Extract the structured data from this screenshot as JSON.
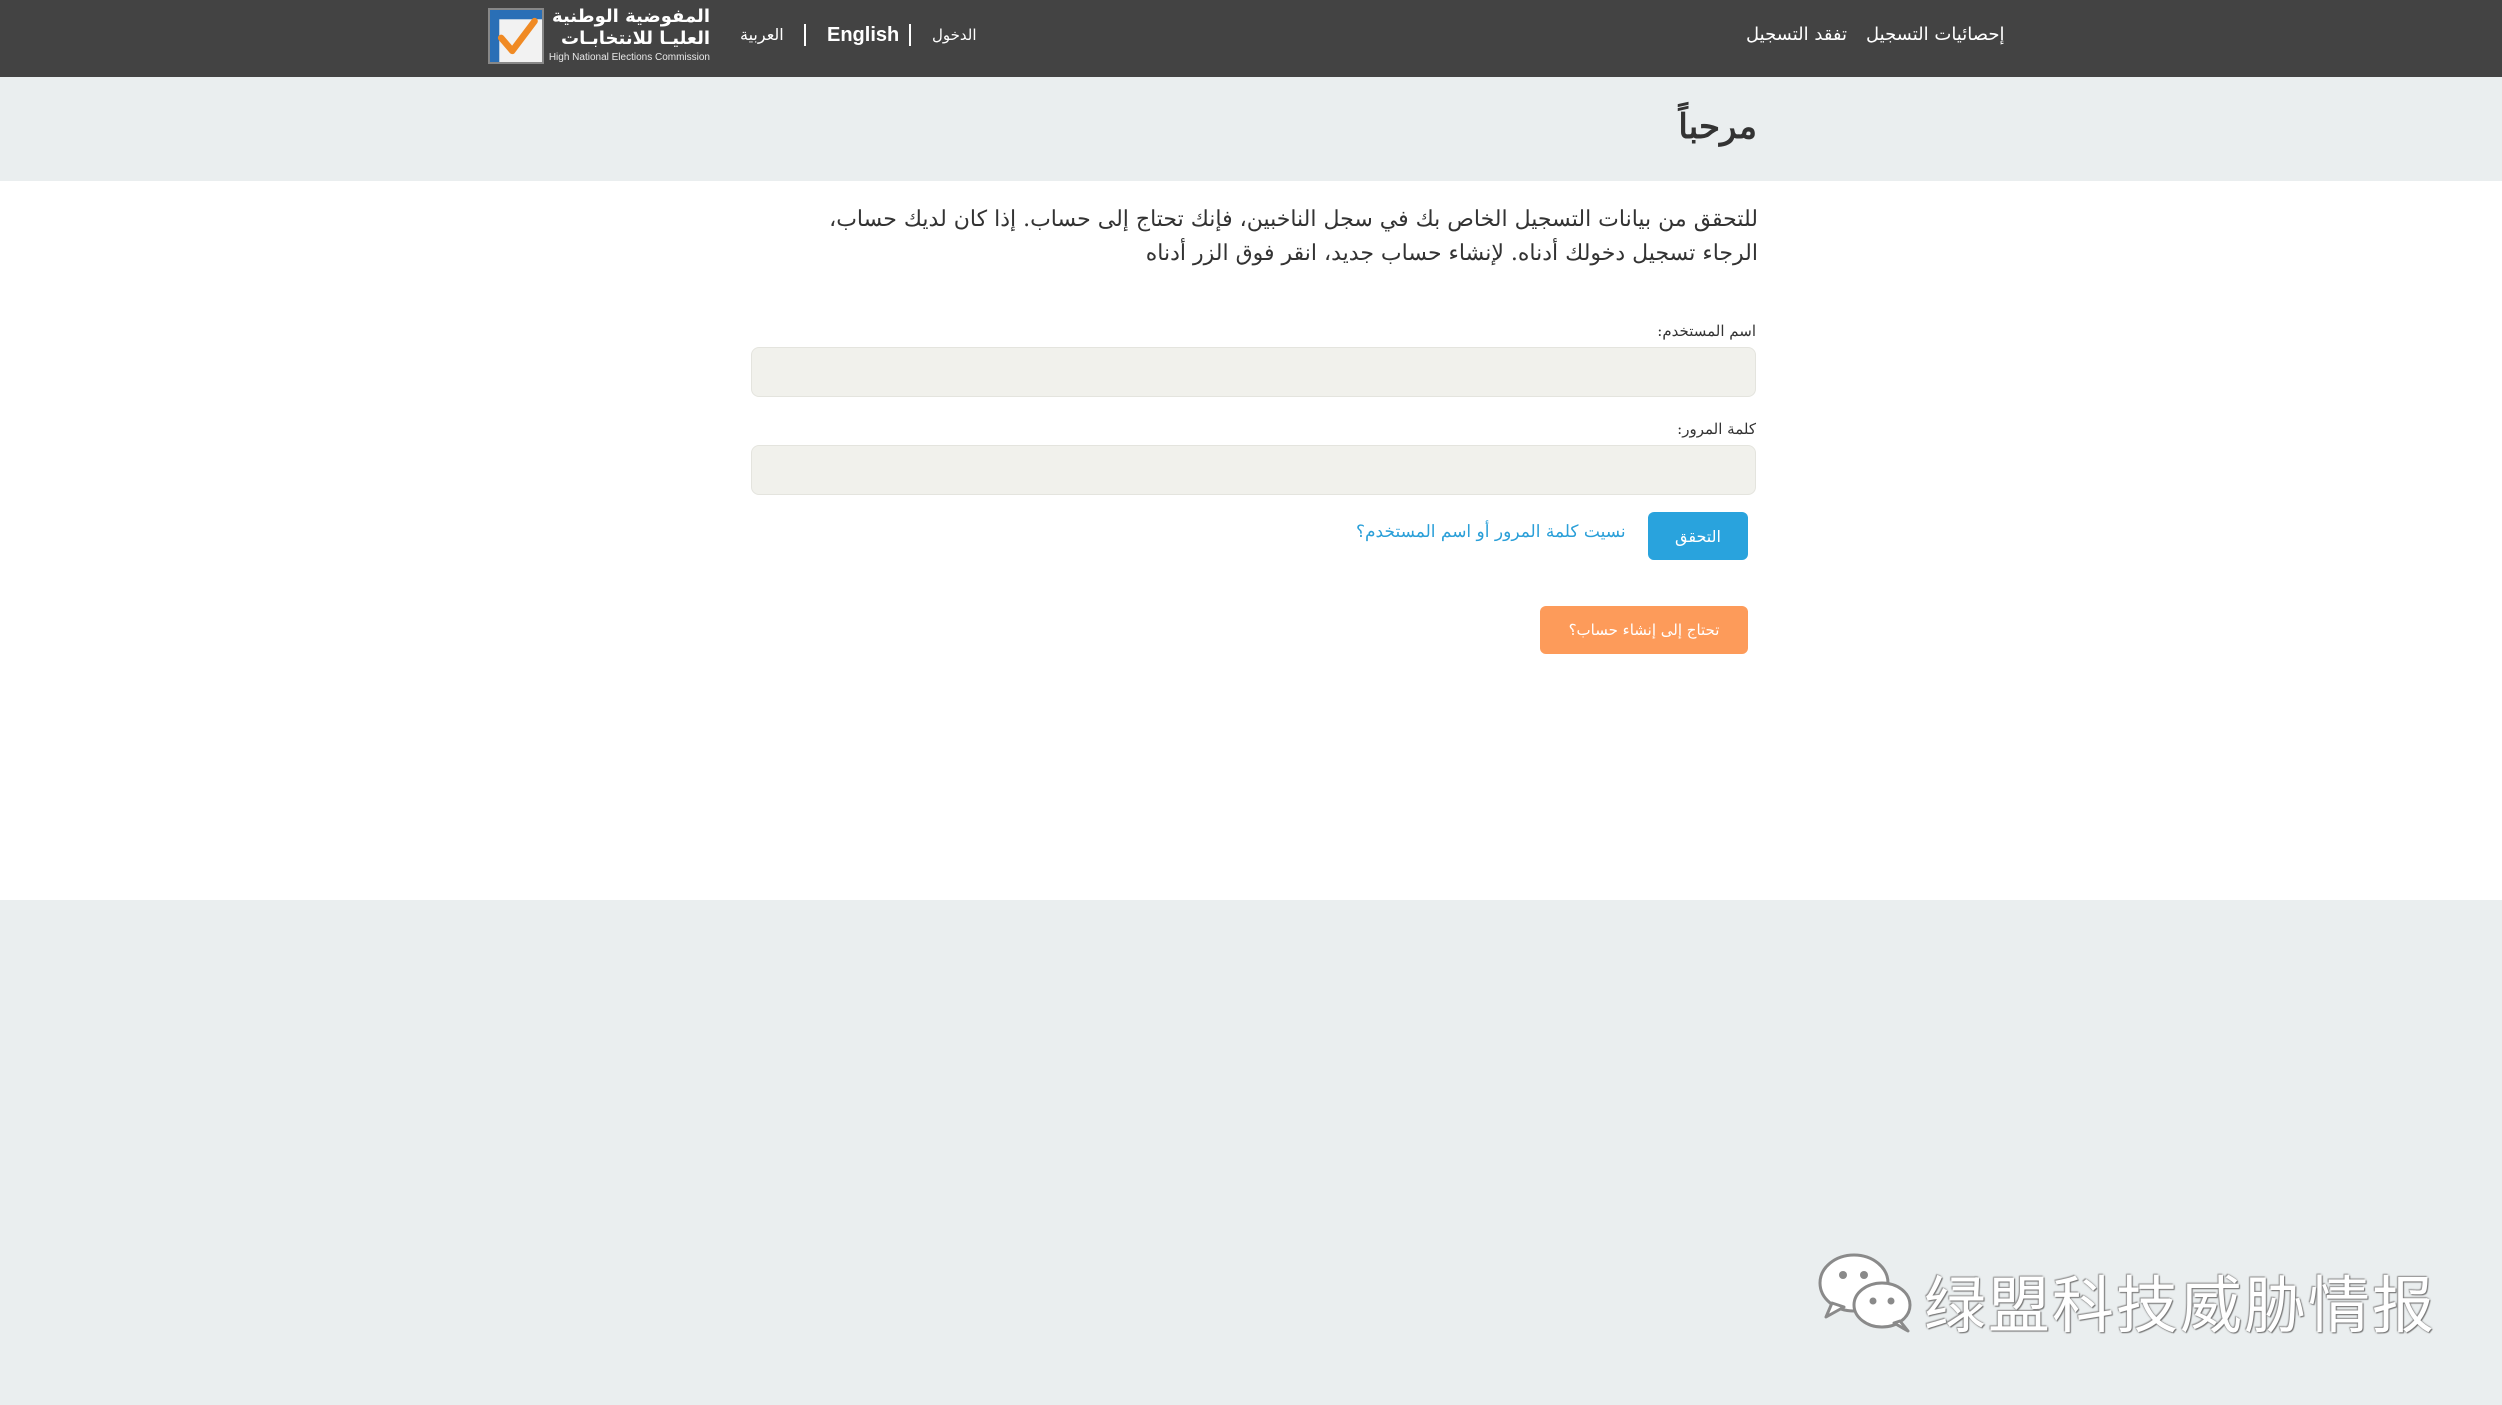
{
  "topbar": {
    "logo": {
      "arabic_line1": "المفوضية الوطنية",
      "arabic_line2": "العليـا للانتخابـات",
      "english": "High National Elections Commission"
    },
    "lang_arabic": "العربية",
    "lang_english": "English",
    "login": "الدخول",
    "nav_check_registration": "تفقد التسجيل",
    "nav_registration_stats": "إحصائيات التسجيل"
  },
  "header": {
    "title": "مرحباً"
  },
  "main": {
    "intro_text": "للتحقق من بيانات التسجيل الخاص بك في سجل الناخبين، فإنك تحتاج إلى حساب. إذا كان لديك حساب، الرجاء تسجيل دخولك أدناه. لإنشاء حساب جديد، انقر فوق الزر أدناه",
    "username_label": "اسم المستخدم:",
    "username_value": "",
    "password_label": "كلمة المرور:",
    "password_value": "",
    "verify_button": "التحقق",
    "forgot_link": "نسيت كلمة المرور أو اسم المستخدم؟",
    "create_account_button": "تحتاج إلى إنشاء حساب؟"
  },
  "watermark": {
    "text": "绿盟科技威胁情报",
    "icon": "wechat-icon"
  },
  "colors": {
    "topbar_bg": "#434343",
    "page_bg": "#eaeeef",
    "panel_bg": "#ffffff",
    "primary_button": "#29a3dd",
    "secondary_button": "#fd9b5a",
    "link": "#2a9fd8"
  }
}
